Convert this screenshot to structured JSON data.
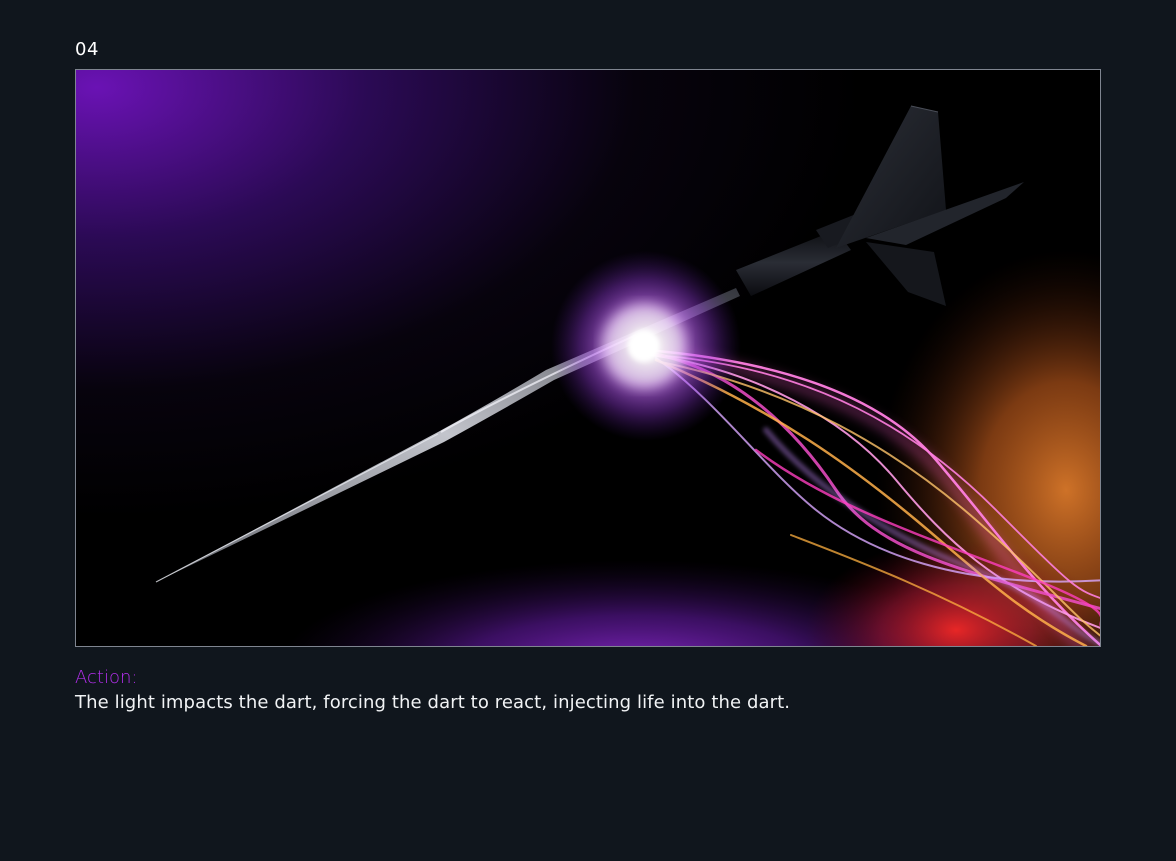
{
  "frame": {
    "number": "04",
    "action_label": "Action:",
    "action_text": "The light impacts the dart, forcing the dart to react, injecting life into the dart.",
    "accent_color": "#b62ff0",
    "background_color": "#10161d"
  },
  "image": {
    "subject": "dart-with-light-trails",
    "icon": "dart-illustration"
  }
}
